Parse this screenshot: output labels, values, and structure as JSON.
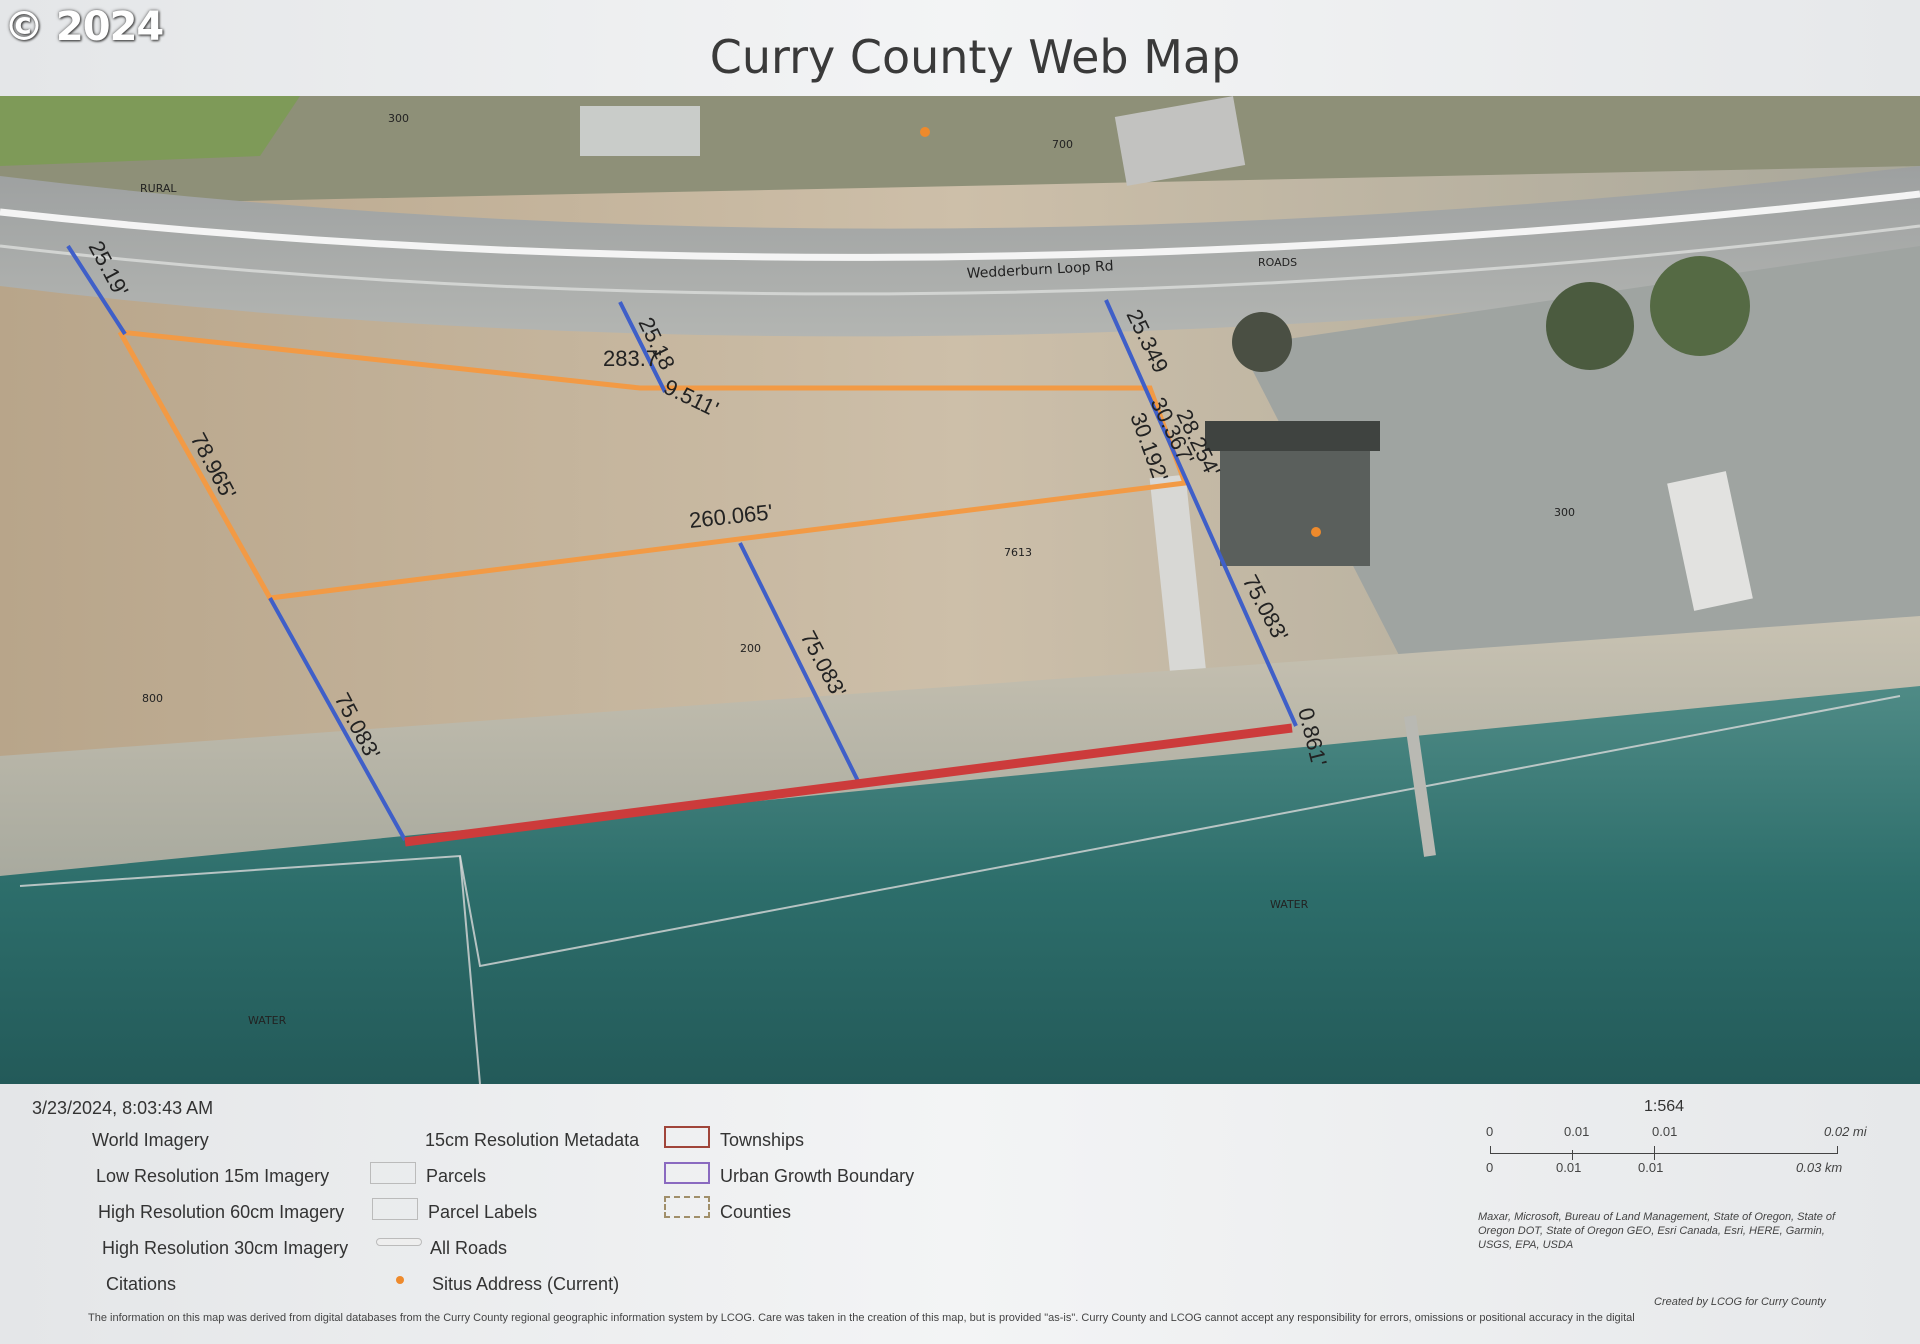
{
  "copyright": "© 2024",
  "title": "Curry County Web Map",
  "map": {
    "road_name": "Wedderburn Loop Rd",
    "labels": {
      "roads": "ROADS",
      "rural": "RURAL",
      "water_center": "WATER",
      "water_left": "WATER",
      "parcel_code": "7613",
      "num_300": "300",
      "num_700_top": "700",
      "num_800": "800",
      "num_200": "200",
      "num_300_right": "300"
    },
    "dimensions": {
      "d1": "25.19'",
      "d2": "283.7'",
      "d3": "25.18",
      "d4": "9.511'",
      "d5": "25.349",
      "d6": "30.367'",
      "d7": "28.254'",
      "d8": "30.192'",
      "d9": "78.965'",
      "d10": "260.065'",
      "d11": "75.083'",
      "d12": "75.083'",
      "d13": "75.083'",
      "d14": "0.861'"
    }
  },
  "footer": {
    "timestamp": "3/23/2024, 8:03:43 AM",
    "legend_left": [
      "World Imagery",
      "Low Resolution 15m Imagery",
      "High Resolution 60cm Imagery",
      "High Resolution 30cm Imagery",
      "Citations"
    ],
    "legend_mid": [
      "15cm Resolution Metadata",
      "Parcels",
      "Parcel Labels",
      "All Roads",
      "Situs Address (Current)"
    ],
    "legend_right": [
      "Townships",
      "Urban Growth Boundary",
      "Counties"
    ],
    "scale_ratio": "1:564",
    "scale_top": [
      "0",
      "0.01",
      "0.01",
      "0.02 mi"
    ],
    "scale_bottom": [
      "0",
      "0.01",
      "0.01",
      "0.03 km"
    ],
    "attribution": "Maxar, Microsoft, Bureau of Land Management, State of Oregon, State of Oregon DOT, State of Oregon GEO, Esri Canada, Esri, HERE, Garmin, USGS, EPA, USDA",
    "created_by": "Created by LCOG for Curry County",
    "disclaimer": "The information on this map was derived from digital databases from the Curry County regional geographic information system by LCOG. Care was taken in the creation of this map, but is provided \"as-is\". Curry County and LCOG cannot accept any responsibility for errors, omissions or positional accuracy in the digital"
  },
  "colors": {
    "parcel_outline": "#f29a45",
    "dimension_line": "#3f5fc8",
    "red_line": "#cc3b3b",
    "water": "#2a6b6a",
    "ground": "#b9a88f"
  }
}
